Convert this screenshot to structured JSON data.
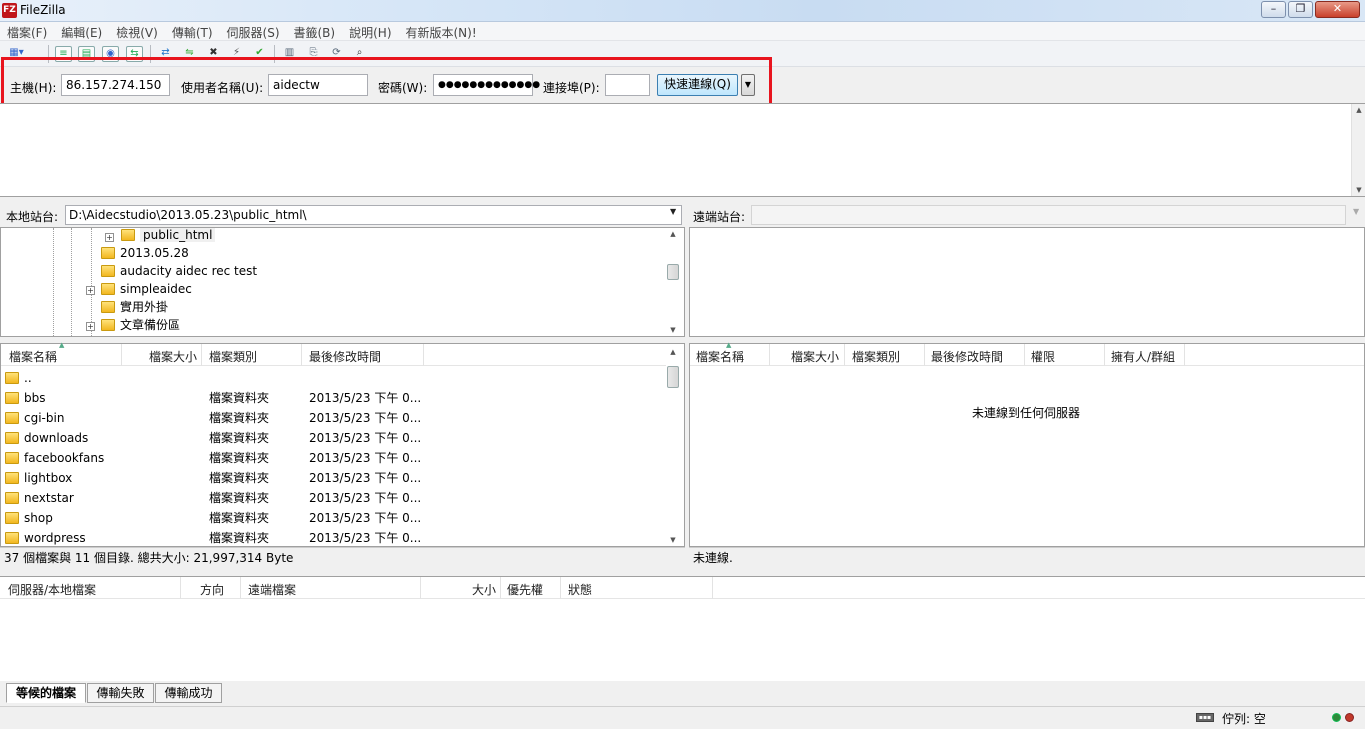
{
  "window": {
    "title": "FileZilla",
    "logo": "FZ",
    "controls": [
      "–",
      "❐",
      "✕"
    ]
  },
  "menu": [
    "檔案(F)",
    "編輯(E)",
    "檢視(V)",
    "傳輸(T)",
    "伺服器(S)",
    "書籤(B)",
    "說明(H)",
    "有新版本(N)!"
  ],
  "toolbar": {
    "icons": [
      "site-manager-icon",
      "toggle-log-icon",
      "toggle-tree-icon",
      "toggle-remote-tree-icon",
      "toggle-queue-icon",
      "refresh-icon",
      "process-queue-icon",
      "cancel-icon",
      "disconnect-icon",
      "reconnect-icon",
      "directory-compare-icon",
      "filter-icon",
      "sync-browse-icon",
      "search-icon"
    ]
  },
  "quickconnect": {
    "host_label": "主機(H):",
    "host_value": "86.157.274.150",
    "user_label": "使用者名稱(U):",
    "user_value": "aidectw",
    "pass_label": "密碼(W):",
    "pass_value": "●●●●●●●●●●●●●",
    "port_label": "連接埠(P):",
    "port_value": "",
    "connect_label": "快速連線(Q)",
    "highlight_color": "#e8141e"
  },
  "local": {
    "site_label": "本地站台:",
    "path": "D:\\Aidecstudio\\2013.05.23\\public_html\\",
    "tree": [
      {
        "name": "public_html",
        "expander": "+"
      },
      {
        "name": "2013.05.28",
        "expander": ""
      },
      {
        "name": "audacity aidec rec test",
        "expander": ""
      },
      {
        "name": "simpleaidec",
        "expander": "+"
      },
      {
        "name": "實用外掛",
        "expander": ""
      },
      {
        "name": "文章備份區",
        "expander": "+"
      }
    ],
    "columns": [
      "檔案名稱",
      "檔案大小",
      "檔案類別",
      "最後修改時間"
    ],
    "files": [
      {
        "name": "..",
        "size": "",
        "type": "",
        "modified": ""
      },
      {
        "name": "bbs",
        "size": "",
        "type": "檔案資料夾",
        "modified": "2013/5/23 下午 0..."
      },
      {
        "name": "cgi-bin",
        "size": "",
        "type": "檔案資料夾",
        "modified": "2013/5/23 下午 0..."
      },
      {
        "name": "downloads",
        "size": "",
        "type": "檔案資料夾",
        "modified": "2013/5/23 下午 0..."
      },
      {
        "name": "facebookfans",
        "size": "",
        "type": "檔案資料夾",
        "modified": "2013/5/23 下午 0..."
      },
      {
        "name": "lightbox",
        "size": "",
        "type": "檔案資料夾",
        "modified": "2013/5/23 下午 0..."
      },
      {
        "name": "nextstar",
        "size": "",
        "type": "檔案資料夾",
        "modified": "2013/5/23 下午 0..."
      },
      {
        "name": "shop",
        "size": "",
        "type": "檔案資料夾",
        "modified": "2013/5/23 下午 0..."
      },
      {
        "name": "wordpress",
        "size": "",
        "type": "檔案資料夾",
        "modified": "2013/5/23 下午 0..."
      }
    ],
    "status": "37 個檔案與 11 個目錄. 總共大小: 21,997,314 Byte"
  },
  "remote": {
    "site_label": "遠端站台:",
    "path": "",
    "columns": [
      "檔案名稱",
      "檔案大小",
      "檔案類別",
      "最後修改時間",
      "權限",
      "擁有人/群組"
    ],
    "empty_message": "未連線到任何伺服器",
    "status": "未連線."
  },
  "queue": {
    "columns": [
      "伺服器/本地檔案",
      "方向",
      "遠端檔案",
      "大小",
      "優先權",
      "狀態"
    ],
    "tabs": [
      "等候的檔案",
      "傳輸失敗",
      "傳輸成功"
    ],
    "status": "佇列: 空"
  },
  "colors": {
    "led_green": "#2e8b3a",
    "led_red": "#c0392b"
  }
}
